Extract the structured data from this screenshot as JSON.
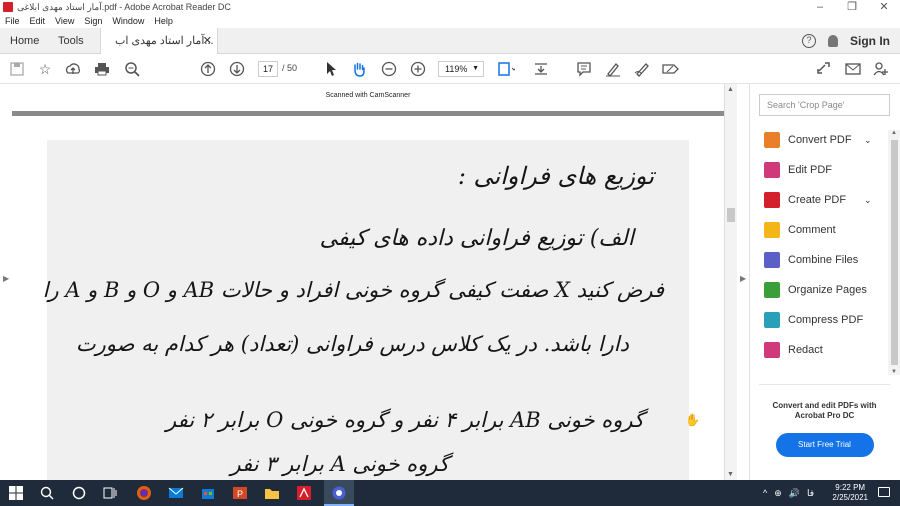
{
  "window": {
    "title": "آمار استاد مهدی ابلاغی.pdf - Adobe Acrobat Reader DC",
    "controls": [
      "–",
      "❐",
      "✕"
    ]
  },
  "menu": [
    "File",
    "Edit",
    "View",
    "Sign",
    "Window",
    "Help"
  ],
  "tabs": {
    "home": "Home",
    "tools": "Tools",
    "document": "آمار  استاد مهدی اب...",
    "close": "✕"
  },
  "header_right": {
    "help": "?",
    "sign_in": "Sign In"
  },
  "toolbar": {
    "page_current": "17",
    "page_total": "/ 50",
    "zoom": "119%",
    "icons": [
      "save-icon",
      "star-icon",
      "upload-icon",
      "print-icon",
      "zoom-search-icon",
      "page-up-icon",
      "page-down-icon",
      "select-arrow-icon",
      "hand-icon",
      "zoom-out-icon",
      "zoom-in-icon",
      "fit-page-icon",
      "scroll-mode-icon",
      "comment-icon",
      "highlight-icon",
      "sign-pen-icon",
      "fill-sign-icon",
      "share-link-icon",
      "mail-icon",
      "add-user-icon"
    ]
  },
  "document": {
    "scanned_label": "Scanned with CamScanner",
    "lines": [
      "توزیع های فراوانی :",
      "الف) توزیع فراوانی داده های کیفی",
      "فرض کنید X صفت کیفی گروه خونی افراد و حالات AB و O و B و A را",
      "دارا باشد. در یک کلاس درس فراوانی (تعداد) هر کدام به صورت",
      "گروه خونی AB برابر ۴ نفر  و  گروه خونی O برابر ۲ نفر",
      "گروه خونی A برابر ۳ نفر"
    ]
  },
  "right_pane": {
    "search_placeholder": "Search 'Crop Page'",
    "tools": [
      {
        "label": "Convert PDF",
        "color": "#e8802a",
        "has_chevron": true
      },
      {
        "label": "Edit PDF",
        "color": "#d0397a",
        "has_chevron": false
      },
      {
        "label": "Create PDF",
        "color": "#d4202a",
        "has_chevron": true
      },
      {
        "label": "Comment",
        "color": "#f2b619",
        "has_chevron": false
      },
      {
        "label": "Combine Files",
        "color": "#5b5fc7",
        "has_chevron": false
      },
      {
        "label": "Organize Pages",
        "color": "#3a9e3a",
        "has_chevron": false
      },
      {
        "label": "Compress PDF",
        "color": "#2aa0b8",
        "has_chevron": false
      },
      {
        "label": "Redact",
        "color": "#d0397a",
        "has_chevron": false
      }
    ],
    "promo_text": "Convert and edit PDFs with Acrobat Pro DC",
    "promo_button": "Start Free Trial"
  },
  "taskbar": {
    "time": "9:22 PM",
    "date": "2/25/2021",
    "lang": "فا",
    "tray": [
      "^",
      "⊕",
      "🔊"
    ]
  }
}
